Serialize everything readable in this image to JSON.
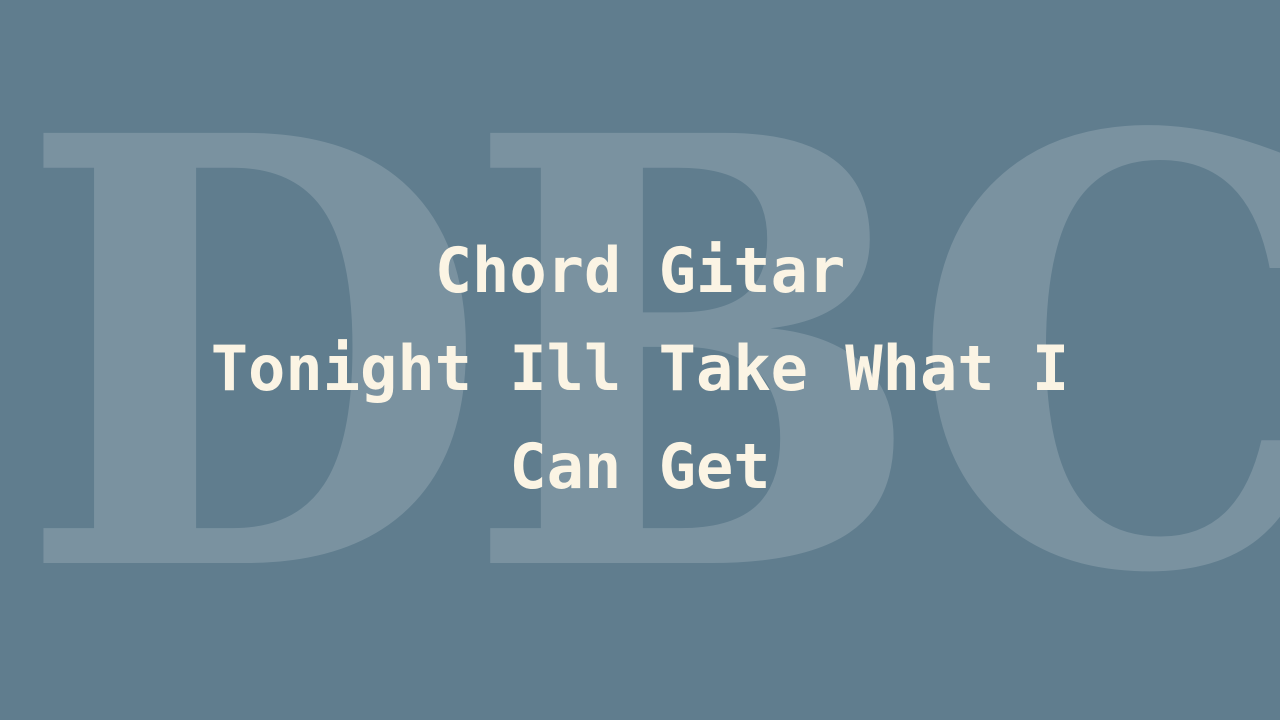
{
  "watermark": {
    "text": "DBC"
  },
  "title": {
    "line1": "Chord Gitar",
    "line2": "Tonight Ill Take What I",
    "line3": "Can Get"
  },
  "colors": {
    "background": "#607d8e",
    "title": "#fbf4e4",
    "watermark": "#ffffff"
  }
}
